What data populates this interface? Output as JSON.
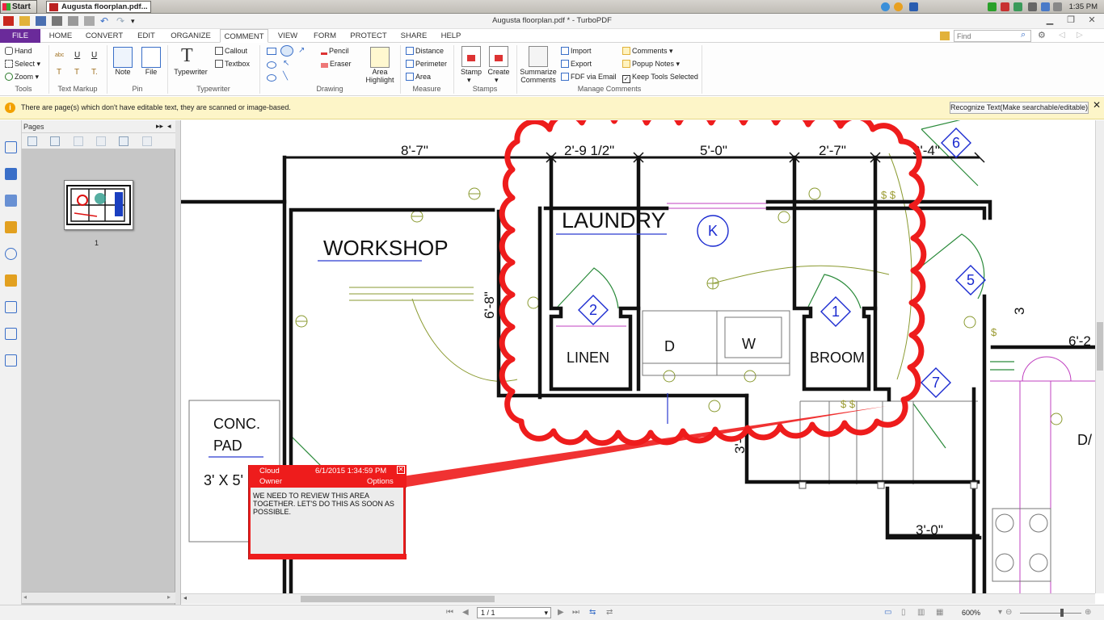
{
  "taskbar": {
    "start_label": "Start",
    "task_label": "Augusta floorplan.pdf...",
    "clock": "1:35 PM",
    "tray_icons": [
      "network-icon",
      "shield-icon",
      "volume-icon",
      "battery-icon",
      "flag-icon"
    ]
  },
  "window": {
    "title": "Augusta floorplan.pdf * - TurboPDF"
  },
  "menu": {
    "tabs": [
      "FILE",
      "HOME",
      "CONVERT",
      "EDIT",
      "ORGANIZE",
      "COMMENT",
      "VIEW",
      "FORM",
      "PROTECT",
      "SHARE",
      "HELP"
    ],
    "active": "COMMENT",
    "find_placeholder": "Find"
  },
  "ribbon": {
    "tools": {
      "hand": "Hand",
      "select": "Select",
      "zoom": "Zoom",
      "label": "Tools"
    },
    "text_markup": {
      "label": "Text Markup"
    },
    "pin": {
      "note": "Note",
      "file": "File",
      "label": "Pin"
    },
    "typewriter": {
      "typewriter": "Typewriter",
      "callout": "Callout",
      "textbox": "Textbox",
      "label": "Typewriter"
    },
    "drawing": {
      "pencil": "Pencil",
      "eraser": "Eraser",
      "area_highlight_1": "Area",
      "area_highlight_2": "Highlight",
      "label": "Drawing"
    },
    "measure": {
      "distance": "Distance",
      "perimeter": "Perimeter",
      "area": "Area",
      "label": "Measure"
    },
    "stamps": {
      "stamp": "Stamp",
      "create": "Create",
      "label": "Stamps"
    },
    "manage": {
      "summarize_1": "Summarize",
      "summarize_2": "Comments",
      "import": "Import",
      "export": "Export",
      "fdf_email": "FDF via Email",
      "comments": "Comments",
      "popup_notes": "Popup Notes",
      "keep_tools": "Keep Tools Selected",
      "label": "Manage Comments"
    }
  },
  "infobar": {
    "message": "There are page(s) which don't have editable text, they are scanned or image-based.",
    "button": "Recognize Text(Make searchable/editable)"
  },
  "pages_panel": {
    "title": "Pages",
    "thumb_label": "1"
  },
  "plan": {
    "rooms": [
      "WORKSHOP",
      "LAUNDRY",
      "LINEN",
      "BROOM",
      "D",
      "W",
      "CONC.",
      "PAD",
      "3' X 5'",
      "D/"
    ],
    "dimensions": [
      "8'-7\"",
      "2'-9 1/2\"",
      "5'-0\"",
      "2'-7\"",
      "3'-4\"",
      "6'-8\"",
      "3'-0\"",
      "6'-2",
      "3"
    ],
    "tags": [
      "K",
      "1",
      "2",
      "5",
      "6",
      "7"
    ]
  },
  "comment": {
    "type": "Cloud",
    "date": "6/1/2015 1:34:59 PM",
    "author": "Owner",
    "options": "Options",
    "text": "WE NEED TO REVIEW THIS AREA TOGETHER. LET'S DO THIS AS SOON AS POSSIBLE.",
    "color": "#ee1c1c"
  },
  "status": {
    "page": "1 / 1",
    "zoom": "600%"
  }
}
